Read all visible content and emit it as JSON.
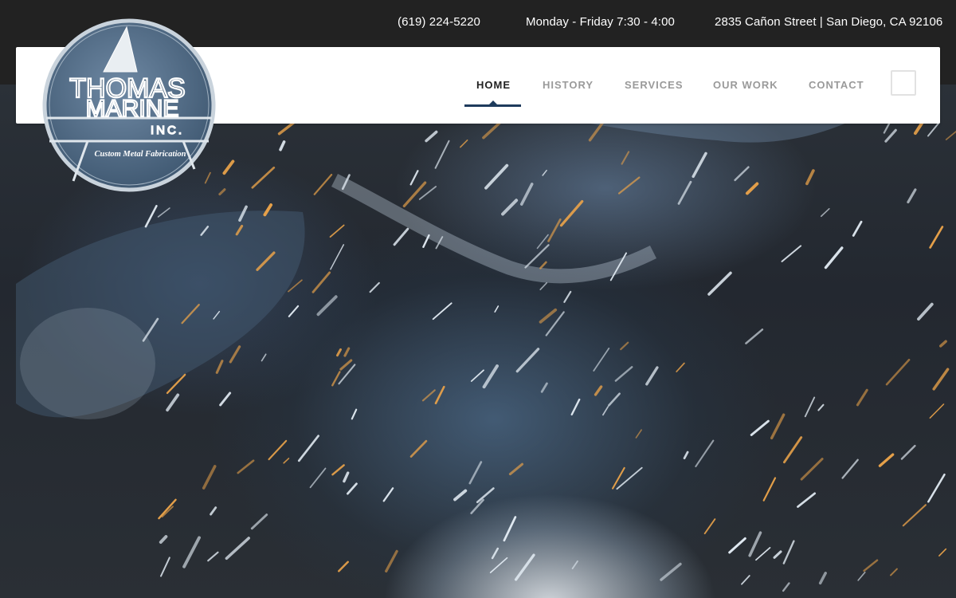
{
  "topbar": {
    "phone": "(619) 224-5220",
    "hours": "Monday - Friday 7:30 - 4:00",
    "address": "2835 Cañon Street | San Diego, CA 92106"
  },
  "logo": {
    "line1": "THOMAS",
    "line2": "MARINE",
    "line3": "INC.",
    "tagline": "Custom Metal Fabrication",
    "color": "#4a6580"
  },
  "nav": {
    "items": [
      {
        "label": "HOME",
        "active": true
      },
      {
        "label": "HISTORY",
        "active": false
      },
      {
        "label": "SERVICES",
        "active": false
      },
      {
        "label": "OUR WORK",
        "active": false
      },
      {
        "label": "CONTACT",
        "active": false
      }
    ],
    "accent": "#1e3b5c",
    "menu_icon": "menu-toggle-icon"
  },
  "hero": {
    "image": "welder-sparks-background",
    "spark_color": "#e8a24a"
  }
}
